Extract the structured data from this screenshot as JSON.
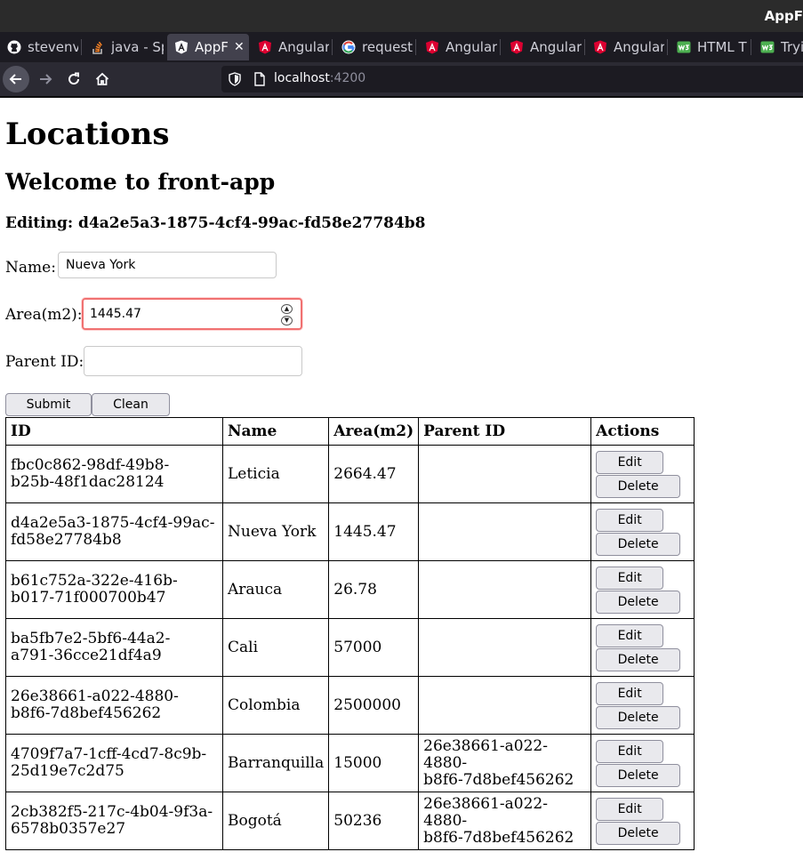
{
  "window": {
    "title": "AppF"
  },
  "tabs": [
    {
      "label": "stevenv",
      "icon": "github-icon",
      "active": false
    },
    {
      "label": "java - Sp",
      "icon": "stackoverflow-icon",
      "active": false
    },
    {
      "label": "AppF",
      "icon": "angular-icon",
      "active": true
    },
    {
      "label": "Angular",
      "icon": "angular-red-icon",
      "active": false
    },
    {
      "label": "request",
      "icon": "google-icon",
      "active": false
    },
    {
      "label": "Angular",
      "icon": "angular-red-icon",
      "active": false
    },
    {
      "label": "Angular",
      "icon": "angular-red-icon",
      "active": false
    },
    {
      "label": "Angular",
      "icon": "angular-red-icon",
      "active": false
    },
    {
      "label": "HTML T",
      "icon": "w3schools-icon",
      "active": false
    },
    {
      "label": "Tryi",
      "icon": "w3schools-icon",
      "active": false
    }
  ],
  "address": {
    "host": "localhost",
    "port": ":4200"
  },
  "page": {
    "title": "Locations",
    "welcome": "Welcome to front-app",
    "editing": "Editing: d4a2e5a3-1875-4cf4-99ac-fd58e27784b8"
  },
  "form": {
    "name_label": "Name:",
    "name_value": "Nueva York",
    "area_label": "Area(m2):",
    "area_value": "1445.47",
    "parent_label": "Parent ID:",
    "parent_value": "",
    "submit_label": "Submit",
    "clean_label": "Clean"
  },
  "table": {
    "headers": [
      "ID",
      "Name",
      "Area(m2)",
      "Parent ID",
      "Actions"
    ],
    "edit_label": "Edit",
    "delete_label": "Delete",
    "rows": [
      {
        "id1": "fbc0c862-98df-49b8-",
        "id2": "b25b-48f1dac28124",
        "name": "Leticia",
        "area": "2664.47",
        "p1": "",
        "p2": ""
      },
      {
        "id1": "d4a2e5a3-1875-4cf4-99ac-",
        "id2": "fd58e27784b8",
        "name": "Nueva York",
        "area": "1445.47",
        "p1": "",
        "p2": ""
      },
      {
        "id1": "b61c752a-322e-416b-",
        "id2": "b017-71f000700b47",
        "name": "Arauca",
        "area": "26.78",
        "p1": "",
        "p2": ""
      },
      {
        "id1": "ba5fb7e2-5bf6-44a2-",
        "id2": "a791-36cce21df4a9",
        "name": "Cali",
        "area": "57000",
        "p1": "",
        "p2": ""
      },
      {
        "id1": "26e38661-a022-4880-",
        "id2": "b8f6-7d8bef456262",
        "name": "Colombia",
        "area": "2500000",
        "p1": "",
        "p2": ""
      },
      {
        "id1": "4709f7a7-1cff-4cd7-8c9b-",
        "id2": "25d19e7c2d75",
        "name": "Barranquilla",
        "area": "15000",
        "p1": "26e38661-a022-4880-",
        "p2": "b8f6-7d8bef456262"
      },
      {
        "id1": "2cb382f5-217c-4b04-9f3a-",
        "id2": "6578b0357e27",
        "name": "Bogotá",
        "area": "50236",
        "p1": "26e38661-a022-4880-",
        "p2": "b8f6-7d8bef456262"
      }
    ]
  },
  "colors": {
    "focus_border": "#f07171",
    "button_bg": "#e9e9ed"
  }
}
